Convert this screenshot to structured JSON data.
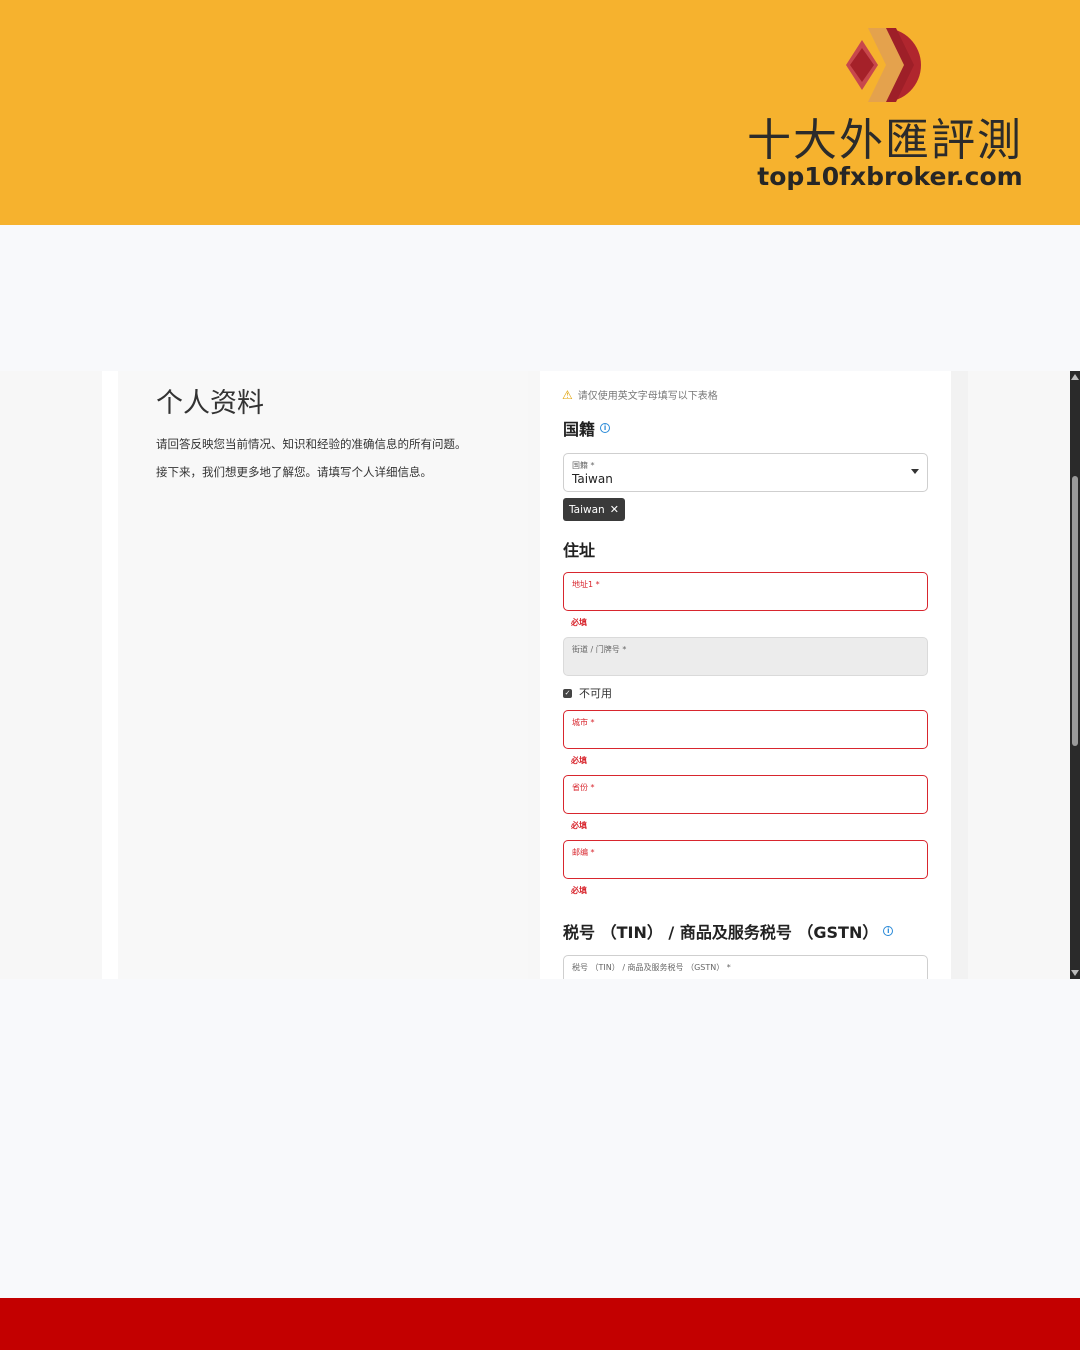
{
  "banner": {
    "brand_cn": "十大外匯評測",
    "brand_url": "top10fxbroker.com",
    "bg_color": "#f6b22e"
  },
  "left": {
    "title": "个人资料",
    "intro1": "请回答反映您当前情况、知识和经验的准确信息的所有问题。",
    "intro2": "接下来，我们想更多地了解您。请填写个人详细信息。"
  },
  "right": {
    "warning": "请仅使用英文字母填写以下表格",
    "nationality_heading": "国籍",
    "nationality_field": {
      "label": "国籍 *",
      "value": "Taiwan"
    },
    "chip_label": "Taiwan",
    "address_heading": "住址",
    "address1": {
      "label": "地址1 *",
      "error": "必填"
    },
    "street": {
      "label": "街道 / 门牌号 *"
    },
    "not_available": "不可用",
    "city": {
      "label": "城市 *",
      "error": "必填"
    },
    "province": {
      "label": "省份 *",
      "error": "必填"
    },
    "postcode": {
      "label": "邮编 *",
      "error": "必填"
    },
    "tax_heading": "税号 （TIN） / 商品及服务税号 （GSTN）",
    "tax_field": {
      "label": "税号 （TIN） / 商品及服务税号 （GSTN） *"
    }
  },
  "colors": {
    "error": "#d8262e",
    "footer": "#c30000"
  }
}
